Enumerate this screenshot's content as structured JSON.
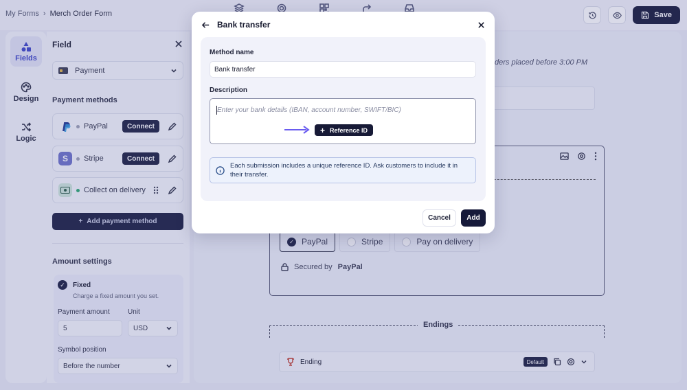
{
  "breadcrumb": {
    "root": "My Forms",
    "separator": "›",
    "current": "Merch Order Form"
  },
  "toolbar": {
    "save_label": "Save"
  },
  "rail": {
    "fields": "Fields",
    "design": "Design",
    "logic": "Logic"
  },
  "panel": {
    "title": "Field",
    "field_type": "Payment",
    "payment_methods_title": "Payment methods",
    "methods": [
      {
        "name": "PayPal",
        "action": "Connect"
      },
      {
        "name": "Stripe",
        "action": "Connect"
      },
      {
        "name": "Collect on delivery"
      }
    ],
    "add_method": "Add payment method",
    "amount_settings_title": "Amount settings",
    "fixed_label": "Fixed",
    "fixed_desc": "Charge a fixed amount you set.",
    "payment_amount_label": "Payment amount",
    "payment_amount_value": "5",
    "unit_label": "Unit",
    "unit_value": "USD",
    "symbol_position_label": "Symbol position",
    "symbol_position_value": "Before the number"
  },
  "canvas": {
    "note": "ders placed before 3:00 PM",
    "options": [
      "PayPal",
      "Stripe",
      "Pay on delivery"
    ],
    "secured_prefix": "Secured by",
    "secured_brand": "PayPal",
    "endings_label": "Endings",
    "ending_label": "Ending",
    "default_badge": "Default"
  },
  "modal": {
    "title": "Bank transfer",
    "method_name_label": "Method name",
    "method_name_value": "Bank transfer",
    "description_label": "Description",
    "description_placeholder": "Enter your bank details (IBAN, account number, SWIFT/BIC)",
    "reference_button": "Reference ID",
    "info_text": "Each submission includes a unique reference ID. Ask customers to include it in their transfer.",
    "cancel_label": "Cancel",
    "add_label": "Add"
  },
  "colors": {
    "primary_dark": "#161a3a",
    "accent": "#3e46c8",
    "info_bg": "#edf2fc",
    "arrow": "#6a5cf0"
  }
}
